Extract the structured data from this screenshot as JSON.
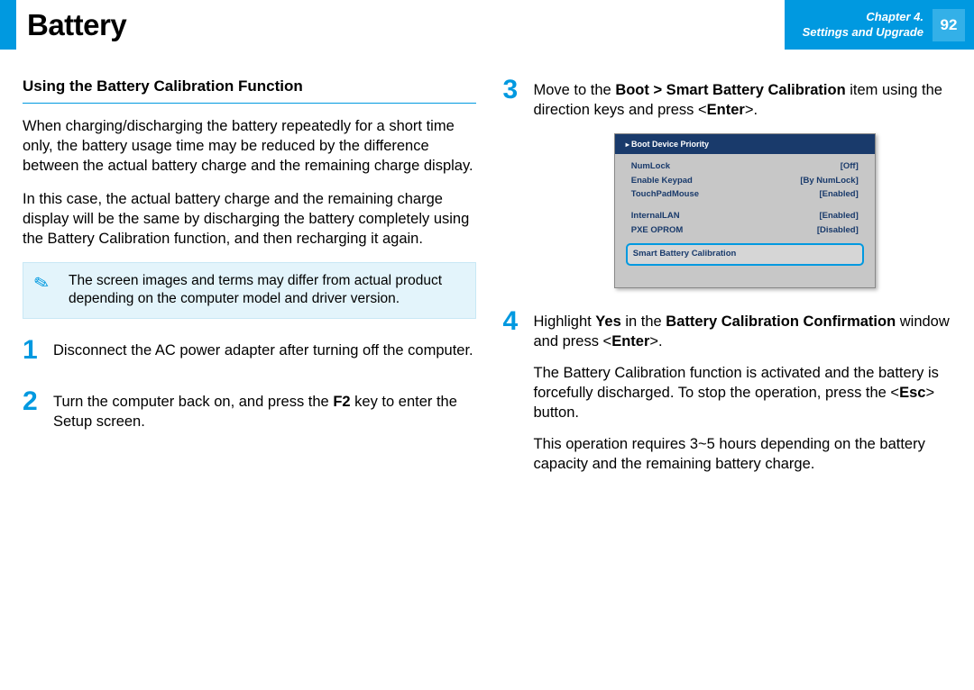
{
  "header": {
    "title": "Battery",
    "chapter_line1": "Chapter 4.",
    "chapter_line2": "Settings and Upgrade",
    "page_number": "92"
  },
  "left": {
    "subheading": "Using the Battery Calibration Function",
    "para1": "When charging/discharging the battery repeatedly for a short time only, the battery usage time may be reduced by the difference between the actual battery charge and the remaining charge display.",
    "para2": "In this case, the actual battery charge and the remaining charge display will be the same by discharging the battery completely using the Battery Calibration function, and then recharging it again.",
    "note": "The screen images and terms may differ from actual product depending on the computer model and driver version.",
    "step1_num": "1",
    "step1_text": "Disconnect the AC power adapter after turning off the computer.",
    "step2_num": "2",
    "step2_pre": "Turn the computer back on, and press the ",
    "step2_bold": "F2",
    "step2_post": " key to enter the Setup screen."
  },
  "right": {
    "step3_num": "3",
    "step3_pre": "Move to the ",
    "step3_bold": "Boot > Smart Battery Calibration",
    "step3_mid": " item using the direction keys and press <",
    "step3_enter": "Enter",
    "step3_post": ">.",
    "bios": {
      "header": "Boot Device Priority",
      "r1k": "NumLock",
      "r1v": "[Off]",
      "r2k": "Enable Keypad",
      "r2v": "[By NumLock]",
      "r3k": "TouchPadMouse",
      "r3v": "[Enabled]",
      "r4k": "InternalLAN",
      "r4v": "[Enabled]",
      "r5k": "PXE OPROM",
      "r5v": "[Disabled]",
      "highlight": "Smart Battery Calibration"
    },
    "step4_num": "4",
    "step4_pre": "Highlight ",
    "step4_b1": "Yes",
    "step4_mid1": " in the ",
    "step4_b2": "Battery Calibration Confirmation",
    "step4_mid2": " window and press <",
    "step4_enter": "Enter",
    "step4_post": ">.",
    "step4_p2_pre": "The Battery Calibration function is activated and the battery is forcefully discharged. To stop the operation, press the <",
    "step4_p2_b": "Esc",
    "step4_p2_post": "> button.",
    "step4_p3": "This operation requires 3~5 hours depending on the battery capacity and the remaining battery charge."
  }
}
